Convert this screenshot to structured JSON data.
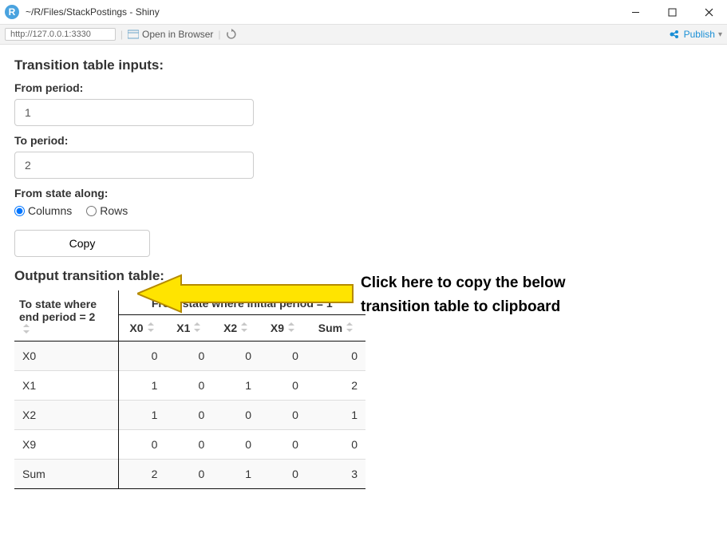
{
  "window": {
    "title": "~/R/Files/StackPostings - Shiny"
  },
  "toolbar": {
    "address": "http://127.0.0.1:3330",
    "openInBrowser": "Open in Browser",
    "publish": "Publish"
  },
  "inputs": {
    "heading": "Transition table inputs:",
    "fromPeriodLabel": "From period:",
    "fromPeriodValue": "1",
    "toPeriodLabel": "To period:",
    "toPeriodValue": "2",
    "fromStateAlongLabel": "From state along:",
    "radio": {
      "columns": "Columns",
      "rows": "Rows",
      "selected": "Columns"
    },
    "copyButton": "Copy"
  },
  "output": {
    "heading": "Output transition table:",
    "rowHeader": "To state where end period = 2",
    "colGroupHeader": "From state where initial period = 1",
    "columns": [
      "X0",
      "X1",
      "X2",
      "X9",
      "Sum"
    ],
    "rows": [
      {
        "label": "X0",
        "values": [
          0,
          0,
          0,
          0,
          0
        ]
      },
      {
        "label": "X1",
        "values": [
          1,
          0,
          1,
          0,
          2
        ]
      },
      {
        "label": "X2",
        "values": [
          1,
          0,
          0,
          0,
          1
        ]
      },
      {
        "label": "X9",
        "values": [
          0,
          0,
          0,
          0,
          0
        ]
      },
      {
        "label": "Sum",
        "values": [
          2,
          0,
          1,
          0,
          3
        ]
      }
    ]
  },
  "annotation": {
    "text": "Click here to copy the below\ntransition table to clipboard"
  }
}
